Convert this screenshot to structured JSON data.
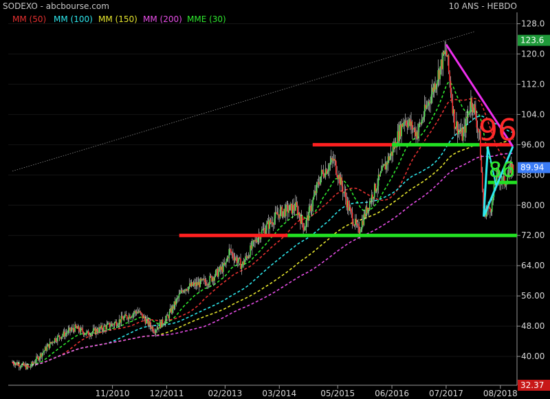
{
  "header": {
    "left": "SODEXO - abcbourse.com",
    "right": "10 ANS - HEBDO"
  },
  "legend": [
    {
      "label": "MM (50)",
      "color": "#e53030"
    },
    {
      "label": "MM (100)",
      "color": "#2ee8ee"
    },
    {
      "label": "MM (150)",
      "color": "#e8e82e"
    },
    {
      "label": "MM (200)",
      "color": "#e84ee8"
    },
    {
      "label": "MME (30)",
      "color": "#2ee82e"
    }
  ],
  "chart_data": {
    "type": "candlestick",
    "ylim": [
      32.37,
      131
    ],
    "y_ticks": [
      40.0,
      48.0,
      56.0,
      64.0,
      72.0,
      80.0,
      88.0,
      96.0,
      104.0,
      112.0,
      120.0,
      128.0
    ],
    "y_tick_labels": [
      "40.00",
      "48.00",
      "56.00",
      "64.00",
      "72.00",
      "80.00",
      "88.00",
      "96.00",
      "104.0",
      "112.0",
      "120.0",
      "128.0"
    ],
    "x_labels": [
      "11/2010",
      "12/2011",
      "02/2013",
      "03/2014",
      "05/2015",
      "06/2016",
      "07/2017",
      "08/2018"
    ],
    "x_range": [
      "2008-11",
      "2018-11"
    ],
    "price_path": [
      [
        "2008-11",
        38.5
      ],
      [
        "2009-03",
        37.0
      ],
      [
        "2009-09",
        44.5
      ],
      [
        "2010-02",
        47.5
      ],
      [
        "2010-05",
        46.0
      ],
      [
        "2010-11",
        48.5
      ],
      [
        "2011-05",
        52.0
      ],
      [
        "2011-09",
        47.0
      ],
      [
        "2011-12",
        50.0
      ],
      [
        "2012-04",
        58.0
      ],
      [
        "2012-10",
        60.0
      ],
      [
        "2013-02",
        64.0
      ],
      [
        "2013-03",
        68.0
      ],
      [
        "2013-06",
        64.0
      ],
      [
        "2013-10",
        72.0
      ],
      [
        "2014-03",
        78.0
      ],
      [
        "2014-07",
        79.5
      ],
      [
        "2014-09",
        74.0
      ],
      [
        "2015-01",
        88.0
      ],
      [
        "2015-04",
        92.0
      ],
      [
        "2015-08",
        78.0
      ],
      [
        "2015-10",
        73.0
      ],
      [
        "2016-01",
        82.0
      ],
      [
        "2016-05",
        92.0
      ],
      [
        "2016-06",
        94.0
      ],
      [
        "2016-09",
        103.0
      ],
      [
        "2016-12",
        99.0
      ],
      [
        "2017-03",
        108.0
      ],
      [
        "2017-07",
        121.0
      ],
      [
        "2017-09",
        102.0
      ],
      [
        "2017-11",
        98.0
      ],
      [
        "2018-01",
        108.0
      ],
      [
        "2018-02",
        104.0
      ],
      [
        "2018-03",
        98.0
      ],
      [
        "2018-04",
        78.0
      ],
      [
        "2018-06",
        80.0
      ],
      [
        "2018-07",
        88.0
      ],
      [
        "2018-09",
        86.0
      ],
      [
        "2018-10",
        88.5
      ],
      [
        "2018-11",
        89.94
      ]
    ],
    "series": [
      {
        "name": "MM (50)",
        "values": [
          [
            38.5,
            40.0
          ],
          [
            44.0,
            46.5
          ],
          [
            48.0,
            49.0
          ],
          [
            57.0,
            63.0
          ],
          [
            70.0,
            76.0
          ],
          [
            85.0,
            84.0
          ],
          [
            86.0,
            96.0
          ],
          [
            110.0,
            107.0
          ],
          [
            90.0,
            88.5
          ]
        ]
      },
      {
        "name": "MM (100)",
        "values": [
          [
            40.0,
            42.0
          ],
          [
            45.0,
            48.0
          ],
          [
            54.0,
            59.0
          ],
          [
            64.0,
            69.0
          ],
          [
            75.0,
            80.0
          ],
          [
            82.0,
            88.0
          ],
          [
            93.0,
            103.0
          ],
          [
            103.0,
            98.0
          ]
        ]
      },
      {
        "name": "MM (150)",
        "values": [
          [
            46.0,
            50.0
          ],
          [
            55.0,
            60.0
          ],
          [
            65.0,
            71.0
          ],
          [
            75.0,
            80.0
          ],
          [
            87.0,
            92.0
          ],
          [
            96.0,
            97.0
          ]
        ]
      },
      {
        "name": "MM (200)",
        "values": [
          [
            38.0,
            43.0
          ],
          [
            44.0,
            46.5
          ],
          [
            51.0,
            57.0
          ],
          [
            62.0,
            67.0
          ],
          [
            71.0,
            77.0
          ],
          [
            83.0,
            89.0
          ],
          [
            92.0,
            94.0
          ]
        ]
      },
      {
        "name": "MME (30)"
      }
    ],
    "annotations": {
      "label_96": "96",
      "label_86": "86",
      "support_72": 72.0,
      "resistance_96": 96.0,
      "level_86": 86.0,
      "top_line_from": [
        "2017-07",
        122.5
      ],
      "top_line_to": [
        "2018-11",
        95.5
      ]
    },
    "price_badges": [
      {
        "label": "123.6",
        "value": 123.6,
        "color": "#1f9a3a"
      },
      {
        "label": "89.94",
        "value": 89.94,
        "color": "#3b7cf6"
      },
      {
        "label": "32.37",
        "value": 32.37,
        "color": "#c81818"
      }
    ]
  }
}
